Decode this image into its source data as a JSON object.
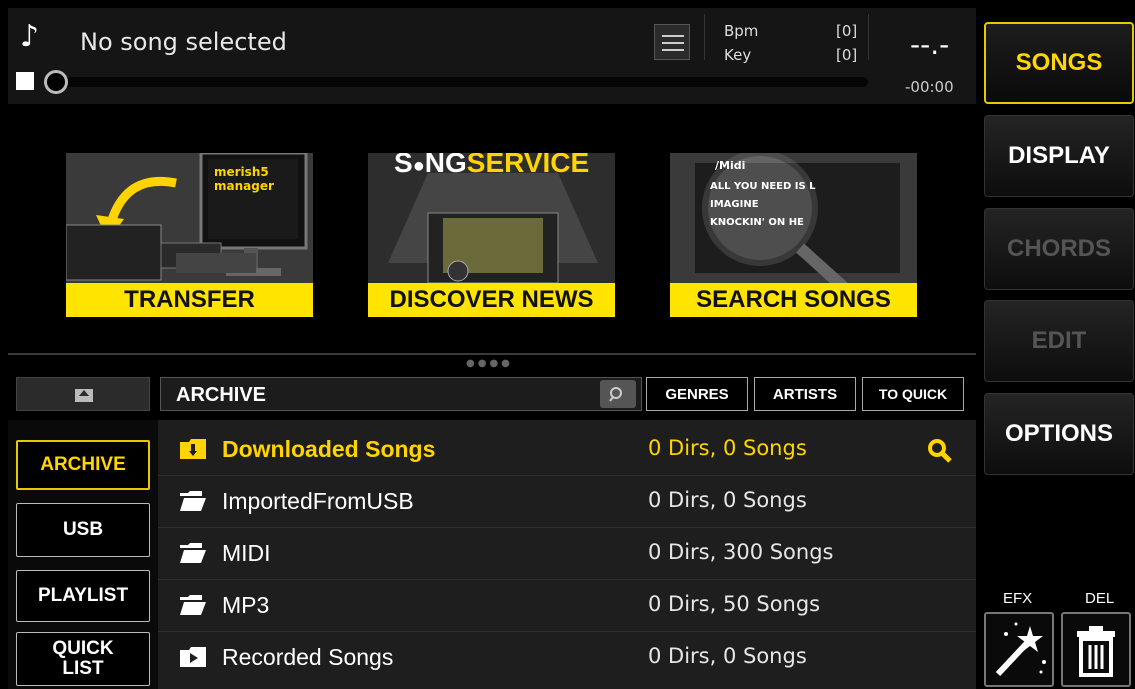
{
  "player": {
    "song_title": "No song selected",
    "bpm_label": "Bpm",
    "bpm_value": "[0]",
    "key_label": "Key",
    "key_value": "[0]",
    "time_display": "--.-",
    "time_remaining": "-00:00",
    "progress": 0
  },
  "banners": [
    {
      "caption": "TRANSFER",
      "logo_text": "merish5 manager"
    },
    {
      "caption": "DISCOVER NEWS",
      "logo_left": "S",
      "logo_mid": "NG",
      "logo_right": "SERVICE"
    },
    {
      "caption": "SEARCH SONGS",
      "folder": "/Midi",
      "songs": [
        "ALL YOU NEED IS L",
        "IMAGINE",
        "KNOCKIN' ON HE"
      ]
    }
  ],
  "right_menu": {
    "songs": "SONGS",
    "display": "DISPLAY",
    "chords": "CHORDS",
    "edit": "EDIT",
    "options": "OPTIONS",
    "efx_label": "EFX",
    "del_label": "DEL"
  },
  "browser": {
    "path": "ARCHIVE",
    "filters": [
      "GENRES",
      "ARTISTS",
      "TO QUICK"
    ],
    "sources": [
      "ARCHIVE",
      "USB",
      "PLAYLIST",
      "QUICK LIST"
    ],
    "rows": [
      {
        "name": "Downloaded Songs",
        "info": "0 Dirs, 0 Songs",
        "icon": "download-folder-icon"
      },
      {
        "name": "ImportedFromUSB",
        "info": "0 Dirs, 0 Songs",
        "icon": "open-folder-icon"
      },
      {
        "name": "MIDI",
        "info": "0 Dirs, 300 Songs",
        "icon": "open-folder-icon"
      },
      {
        "name": "MP3",
        "info": "0 Dirs, 50 Songs",
        "icon": "open-folder-icon"
      },
      {
        "name": "Recorded Songs",
        "info": "0 Dirs, 0 Songs",
        "icon": "play-folder-icon"
      }
    ]
  },
  "colors": {
    "accent": "#ffd600",
    "banner_caption": "#ffe400"
  }
}
